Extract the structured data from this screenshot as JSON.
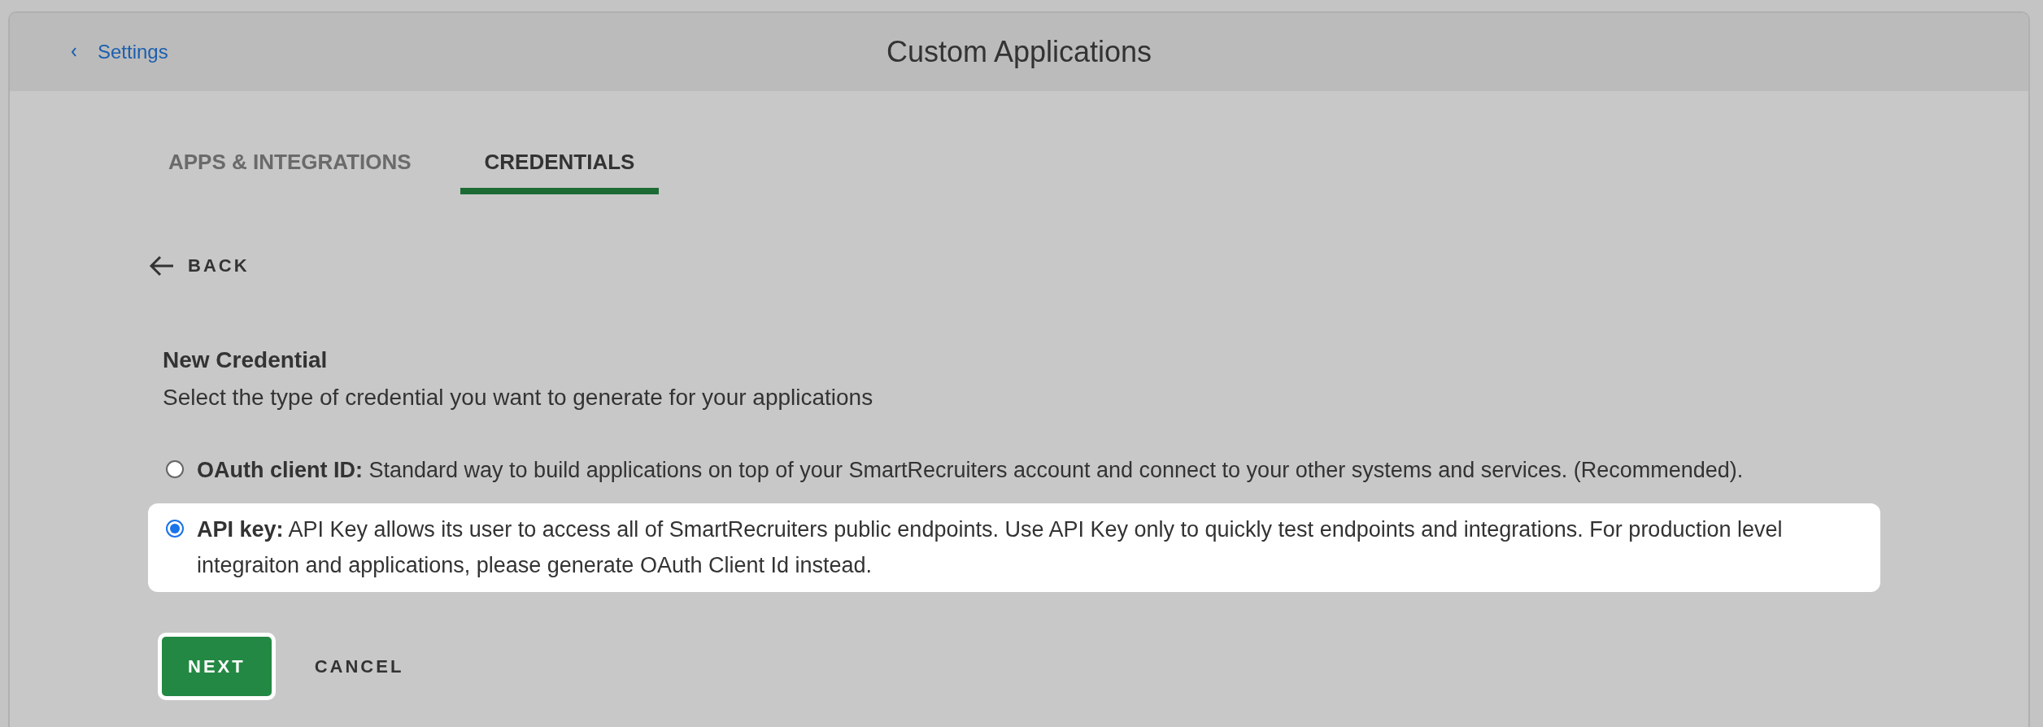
{
  "header": {
    "back_link": "Settings",
    "title": "Custom Applications"
  },
  "tabs": [
    {
      "label": "APPS & INTEGRATIONS",
      "selected": false
    },
    {
      "label": "CREDENTIALS",
      "selected": true
    }
  ],
  "back_button": "BACK",
  "form": {
    "title": "New Credential",
    "subtitle": "Select the type of credential you want to generate for your applications",
    "options": [
      {
        "text": "**OAuth client ID:** Standard way to build applications on top of your SmartRecruiters account and connect to your other systems and services. (Recommended).",
        "selected": false
      },
      {
        "text": "**API key:** API Key allows its user to access all of SmartRecruiters public endpoints. Use API Key only to quickly test endpoints and integrations. For production level integraiton and applications, please generate OAuth Client Id instead.",
        "selected": true
      }
    ]
  },
  "buttons": [
    {
      "label": "NEXT",
      "kind": "primary"
    },
    {
      "label": "CANCEL",
      "kind": "secondary"
    }
  ]
}
